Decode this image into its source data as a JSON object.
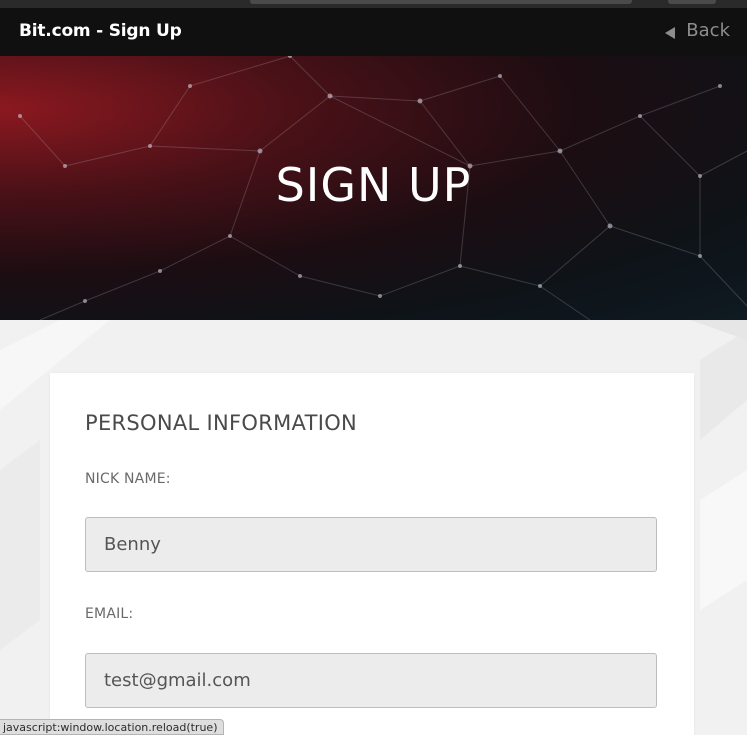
{
  "header": {
    "title": "Bit.com - Sign Up",
    "back_label": "Back",
    "back_icon": "triangle-left-icon"
  },
  "hero": {
    "title": "SIGN UP"
  },
  "form": {
    "section_title": "PERSONAL INFORMATION",
    "fields": [
      {
        "label": "NICK NAME:",
        "value": "Benny"
      },
      {
        "label": "EMAIL:",
        "value": "test@gmail.com"
      }
    ]
  },
  "status_bar": {
    "text": "javascript:window.location.reload(true)"
  },
  "colors": {
    "navbar": "#101010",
    "hero_red": "#8c1820",
    "hero_dark": "#0f1a22",
    "input_bg": "#ececec"
  }
}
